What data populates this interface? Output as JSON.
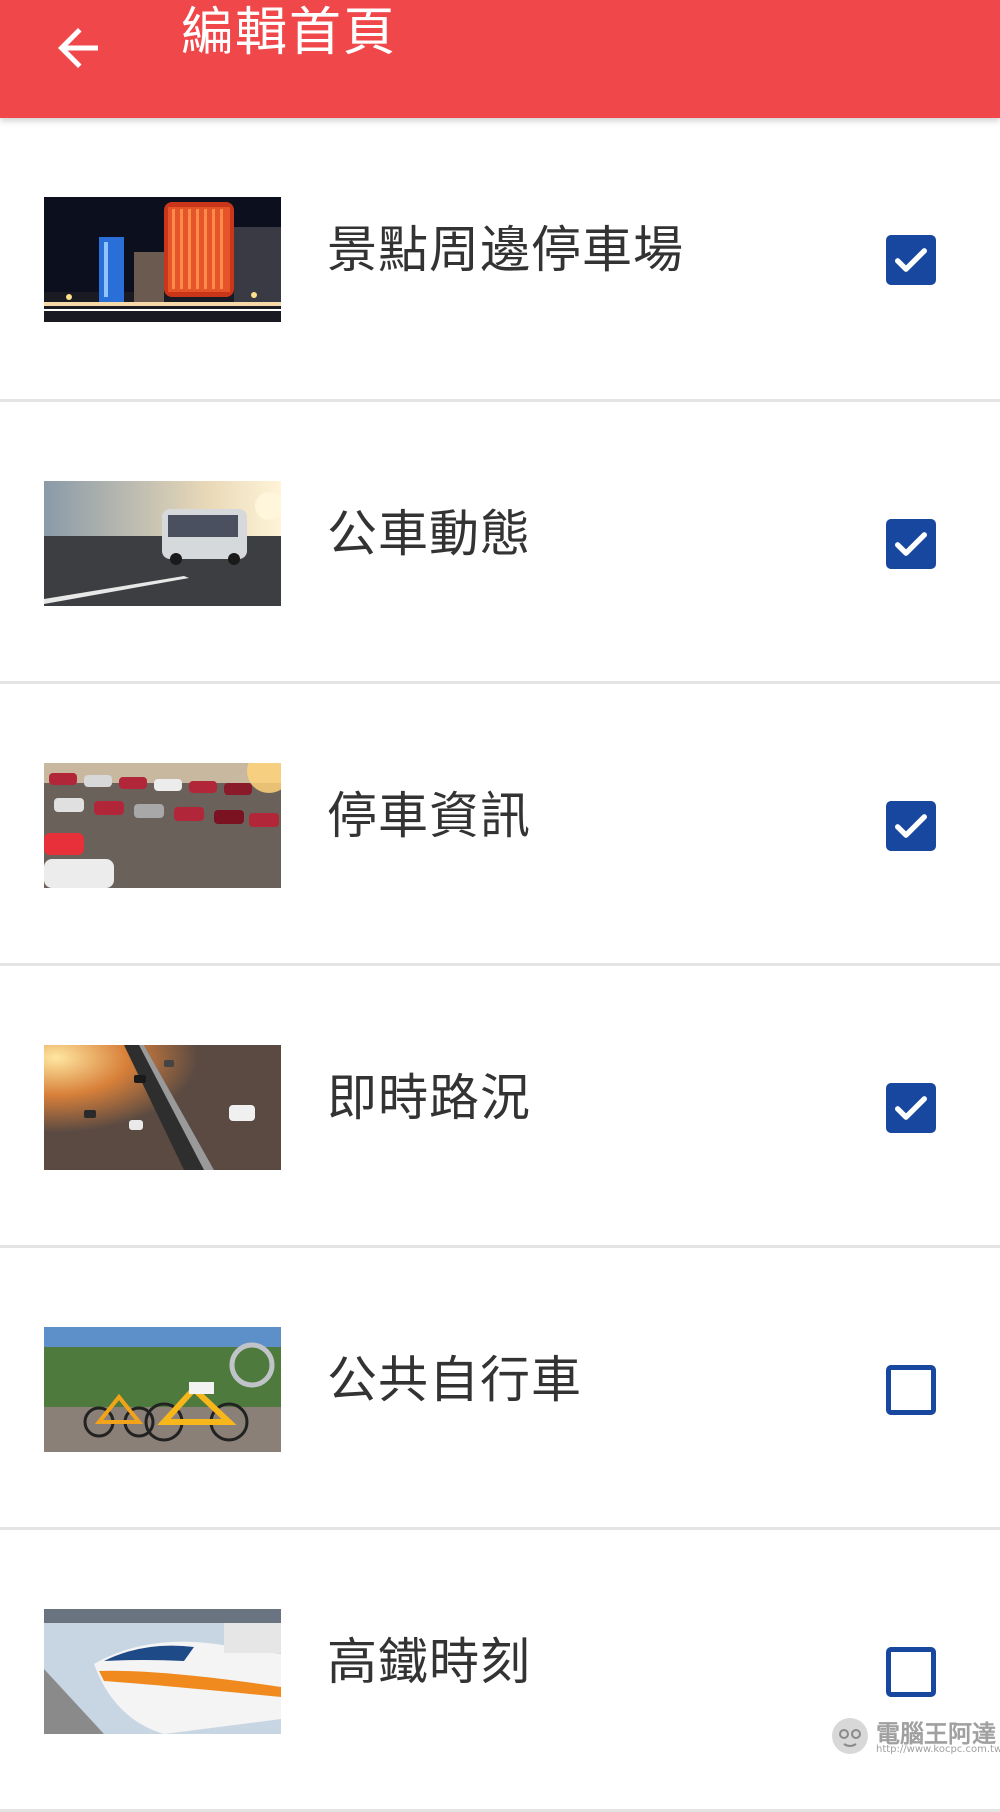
{
  "header": {
    "title": "編輯首頁",
    "background_color": "#f0484a",
    "back_icon": "arrow-left-icon"
  },
  "items": [
    {
      "label": "景點周邊停車場",
      "checked": true,
      "image": "city-night-building"
    },
    {
      "label": "公車動態",
      "checked": true,
      "image": "bus-on-road"
    },
    {
      "label": "停車資訊",
      "checked": true,
      "image": "parked-cars-lot"
    },
    {
      "label": "即時路況",
      "checked": true,
      "image": "highway-traffic-sunset"
    },
    {
      "label": "公共自行車",
      "checked": false,
      "image": "public-bicycles"
    },
    {
      "label": "高鐵時刻",
      "checked": false,
      "image": "high-speed-train"
    }
  ],
  "checkbox_color": "#17479e",
  "watermark": {
    "text": "電腦王阿達",
    "url": "http://www.kocpc.com.tw"
  }
}
